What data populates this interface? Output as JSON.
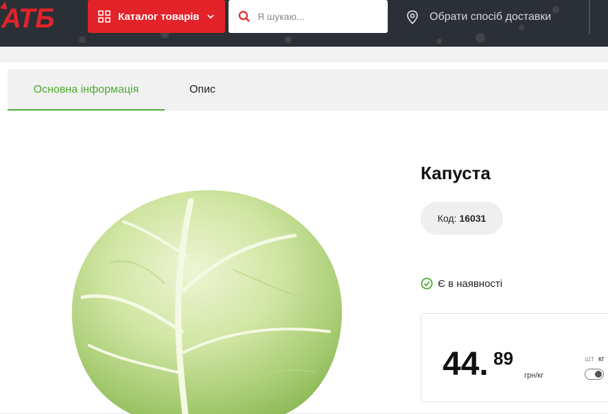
{
  "header": {
    "logo_text": "АТБ",
    "catalog_label": "Каталог товарів",
    "search_placeholder": "Я шукаю...",
    "delivery_label": "Обрати спосіб доставки",
    "colors": {
      "background": "#2b2f36",
      "brand_red": "#e3232a"
    }
  },
  "tabs": [
    {
      "label": "Основна інформація",
      "active": true
    },
    {
      "label": "Опис",
      "active": false
    }
  ],
  "product": {
    "title": "Капуста",
    "code_label": "Код:",
    "code_value": "16031",
    "stock_status": "Є в наявності",
    "price_integer": "44.",
    "price_fraction": "89",
    "price_unit": "грн/кг",
    "unit_options": [
      "шт",
      "кг"
    ],
    "selected_unit": "кг",
    "accent_color": "#4cab2f"
  }
}
